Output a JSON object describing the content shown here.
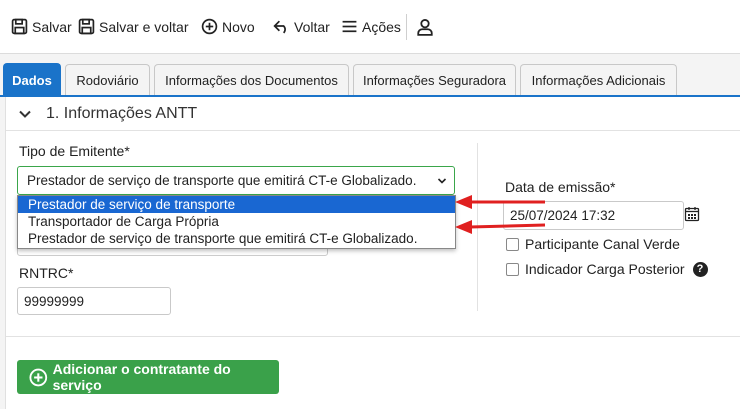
{
  "toolbar": {
    "save": "Salvar",
    "save_back": "Salvar e voltar",
    "new": "Novo",
    "back": "Voltar",
    "actions": "Ações"
  },
  "tabs": [
    {
      "label": "Dados",
      "active": true
    },
    {
      "label": "Rodoviário",
      "active": false
    },
    {
      "label": "Informações dos Documentos",
      "active": false
    },
    {
      "label": "Informações Seguradora",
      "active": false
    },
    {
      "label": "Informações Adicionais",
      "active": false
    }
  ],
  "section": {
    "title": "1. Informações ANTT"
  },
  "form": {
    "tipo_emitente_label": "Tipo de Emitente*",
    "tipo_emitente_value": "Prestador de serviço de transporte que emitirá CT-e Globalizado.",
    "tipo_emitente_options": [
      "Prestador de serviço de transporte",
      "Transportador de Carga Própria",
      "Prestador de serviço de transporte que emitirá CT-e Globalizado."
    ],
    "highlighted_option_index": 0,
    "rntrc_label": "RNTRC*",
    "rntrc_value": "99999999",
    "data_emissao_label": "Data de emissão*",
    "data_emissao_value": "25/07/2024 17:32",
    "participante_canal_verde": "Participante Canal Verde",
    "indicador_carga_posterior": "Indicador Carga Posterior",
    "help_glyph": "?"
  },
  "add_contratante_button": "Adicionar o contratante do serviço",
  "colors": {
    "accent": "#1a73c9",
    "success": "#3aa14a",
    "arrow": "#e02020",
    "highlight": "#1967d2"
  }
}
